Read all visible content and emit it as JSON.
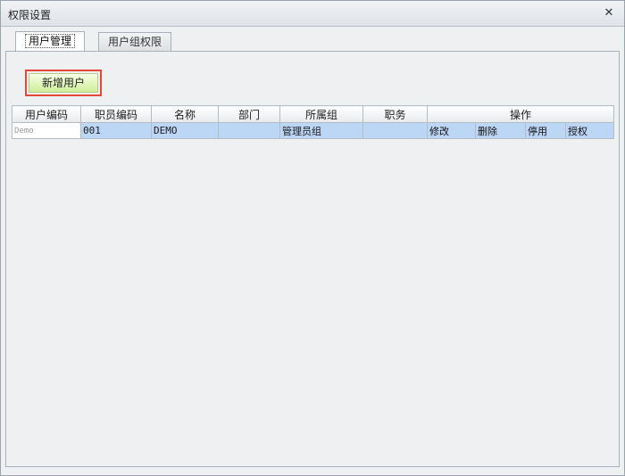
{
  "window": {
    "title": "权限设置",
    "close_icon": "close-icon"
  },
  "tabs": [
    {
      "label": "用户管理",
      "active": true
    },
    {
      "label": "用户组权限",
      "active": false
    }
  ],
  "toolbar": {
    "add_user_label": "新增用户"
  },
  "table": {
    "columns": [
      "用户编码",
      "职员编码",
      "名称",
      "部门",
      "所属组",
      "职务",
      "操作"
    ],
    "rows": [
      {
        "user_code": "Demo",
        "staff_code": "001",
        "name": "DEMO",
        "department": "",
        "group": "管理员组",
        "position": "",
        "actions": [
          "修改",
          "删除",
          "停用",
          "授权"
        ]
      }
    ]
  },
  "colors": {
    "selection": "#bcd6f6",
    "add_button_highlight": "#e5473a",
    "add_button_fill": "#cfee9a"
  }
}
